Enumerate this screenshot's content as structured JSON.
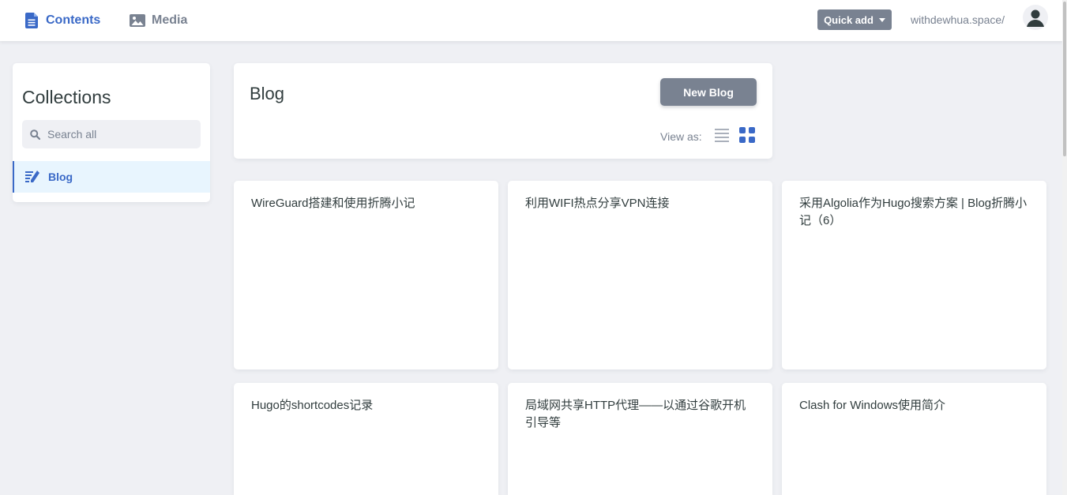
{
  "nav": {
    "contents_label": "Contents",
    "media_label": "Media",
    "quick_add_label": "Quick add",
    "site_url": "withdewhua.space/"
  },
  "sidebar": {
    "title": "Collections",
    "search_placeholder": "Search all",
    "items": [
      {
        "label": "Blog",
        "icon": "write-icon",
        "active": true
      }
    ]
  },
  "collection": {
    "title": "Blog",
    "new_button_label": "New Blog",
    "view_as_label": "View as:",
    "view_mode": "grid"
  },
  "entries": [
    {
      "title": "WireGuard搭建和使用折腾小记"
    },
    {
      "title": "利用WIFI热点分享VPN连接"
    },
    {
      "title": "采用Algolia作为Hugo搜索方案 | Blog折腾小记（6）"
    },
    {
      "title": "Hugo的shortcodes记录"
    },
    {
      "title": "局域网共享HTTP代理——以通过谷歌开机引导等"
    },
    {
      "title": "Clash for Windows使用简介"
    }
  ],
  "colors": {
    "accent": "#3a69c7",
    "grey": "#798291",
    "background": "#eff0f4",
    "active_bg": "#e8f5fe"
  }
}
